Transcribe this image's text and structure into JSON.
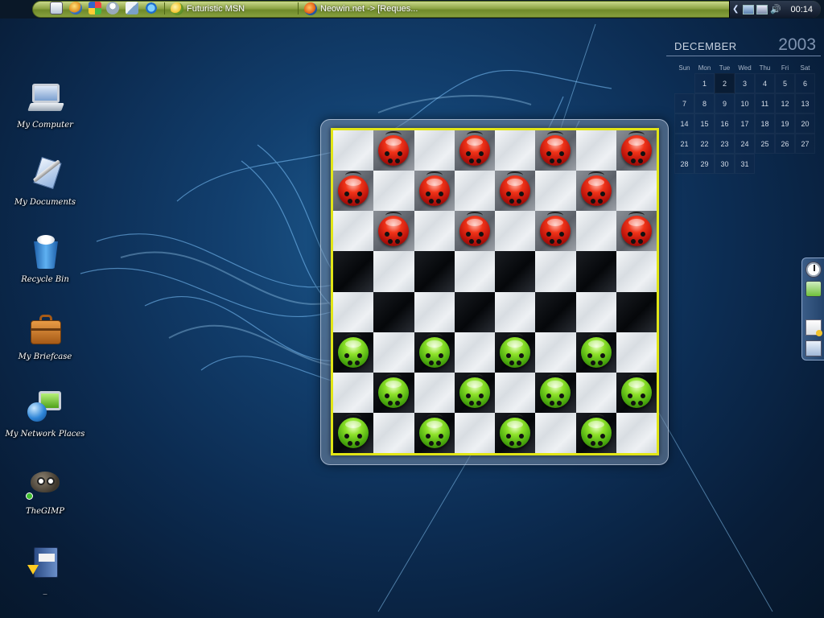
{
  "taskbar": {
    "quicklaunch": [
      {
        "name": "show-desktop-icon",
        "cls": "ql-desk"
      },
      {
        "name": "firefox-quicklaunch-icon",
        "cls": "ql-globe"
      },
      {
        "name": "windows-update-icon",
        "cls": "ql-win"
      },
      {
        "name": "messenger-quicklaunch-icon",
        "cls": "ql-users"
      },
      {
        "name": "email-quicklaunch-icon",
        "cls": "ql-mail"
      },
      {
        "name": "internet-explorer-icon",
        "cls": "ql-ie"
      }
    ],
    "tasks": [
      {
        "label": "Futuristic MSN",
        "icon": "msn-icon"
      },
      {
        "label": "Neowin.net -> [Reques...",
        "icon": "firefox-icon"
      }
    ],
    "clock": "00:14"
  },
  "desktop_icons": [
    {
      "label": "My Computer",
      "icon": "computer-icon"
    },
    {
      "label": "My Documents",
      "icon": "documents-icon"
    },
    {
      "label": "Recycle Bin",
      "icon": "recycle-bin-icon"
    },
    {
      "label": "My Briefcase",
      "icon": "briefcase-icon"
    },
    {
      "label": "My Network Places",
      "icon": "network-places-icon"
    },
    {
      "label": "TheGIMP",
      "icon": "gimp-icon"
    },
    {
      "label": "_",
      "icon": "book-shortcut-icon"
    }
  ],
  "calendar": {
    "month": "DECEMBER",
    "year": "2003",
    "day_names": [
      "Sun",
      "Mon",
      "Tue",
      "Wed",
      "Thu",
      "Fri",
      "Sat"
    ],
    "weeks": [
      [
        "",
        "1",
        "2",
        "3",
        "4",
        "5",
        "6"
      ],
      [
        "7",
        "8",
        "9",
        "10",
        "11",
        "12",
        "13"
      ],
      [
        "14",
        "15",
        "16",
        "17",
        "18",
        "19",
        "20"
      ],
      [
        "21",
        "22",
        "23",
        "24",
        "25",
        "26",
        "27"
      ],
      [
        "28",
        "29",
        "30",
        "31",
        "",
        "",
        ""
      ]
    ],
    "today": "2"
  },
  "dock": [
    {
      "name": "clock-icon"
    },
    {
      "name": "power-icon"
    },
    {
      "name": "notes-icon"
    },
    {
      "name": "window-icon"
    }
  ],
  "board": {
    "size": 8,
    "rows": [
      "-r-r-r-r",
      "r-r-r-r-",
      "-r-r-r-r",
      "--------",
      "--------",
      "g-g-g-g-",
      "-g-g-g-g",
      "g-g-g-g-"
    ],
    "colors": {
      "red": "#d81c10",
      "green": "#5cc414",
      "border": "#e2e616"
    }
  }
}
